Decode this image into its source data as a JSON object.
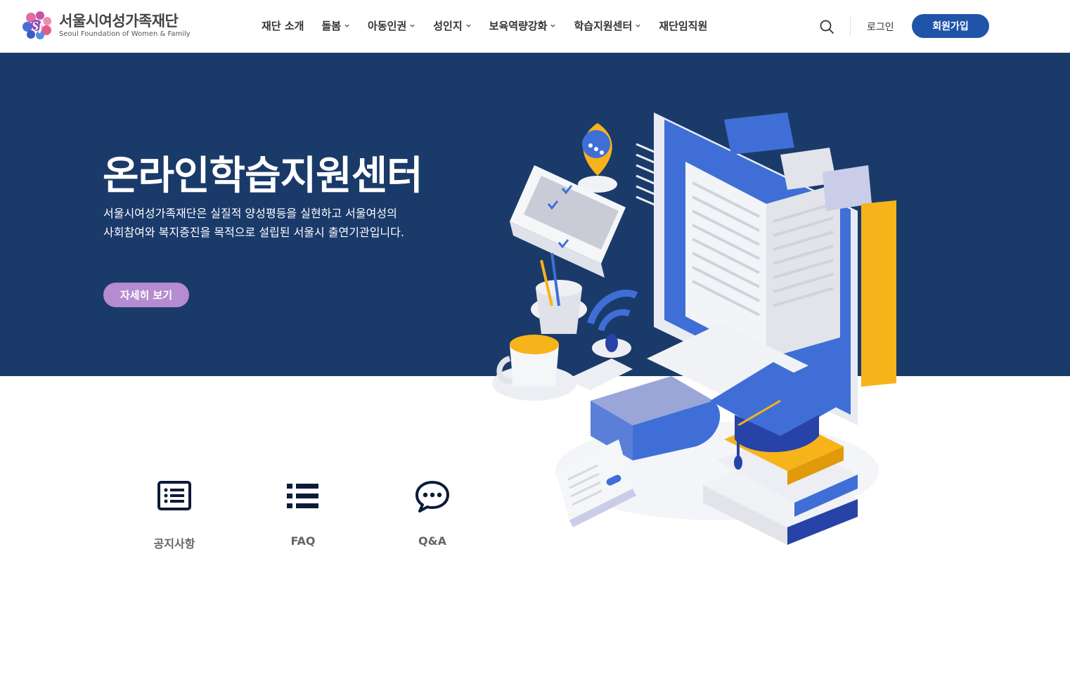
{
  "header": {
    "logo_ko": "서울시여성가족재단",
    "logo_en": "Seoul Foundation of Women & Family",
    "nav": [
      {
        "label": "재단 소개",
        "has_dropdown": false
      },
      {
        "label": "돌봄",
        "has_dropdown": true
      },
      {
        "label": "아동인권",
        "has_dropdown": true
      },
      {
        "label": "성인지",
        "has_dropdown": true
      },
      {
        "label": "보육역량강화",
        "has_dropdown": true
      },
      {
        "label": "학습지원센터",
        "has_dropdown": true
      },
      {
        "label": "재단임직원",
        "has_dropdown": false
      }
    ],
    "login_label": "로그인",
    "signup_label": "회원가입",
    "search_icon": "search-icon"
  },
  "hero": {
    "title": "온라인학습지원센터",
    "desc_line1": "서울시여성가족재단은 실질적 양성평등을 실현하고 서울여성의",
    "desc_line2": "사회참여와 복지증진을 목적으로 설립된 서울시 출연기관입니다.",
    "button_label": "자세히 보기"
  },
  "quick_links": [
    {
      "label": "공지사항",
      "icon": "notice-list-icon"
    },
    {
      "label": "FAQ",
      "icon": "faq-list-icon"
    },
    {
      "label": "Q&A",
      "icon": "chat-bubble-icon"
    }
  ],
  "colors": {
    "hero_bg": "#1a3a6a",
    "signup_bg": "#1f54a8",
    "hero_button": "#b48ccf"
  }
}
